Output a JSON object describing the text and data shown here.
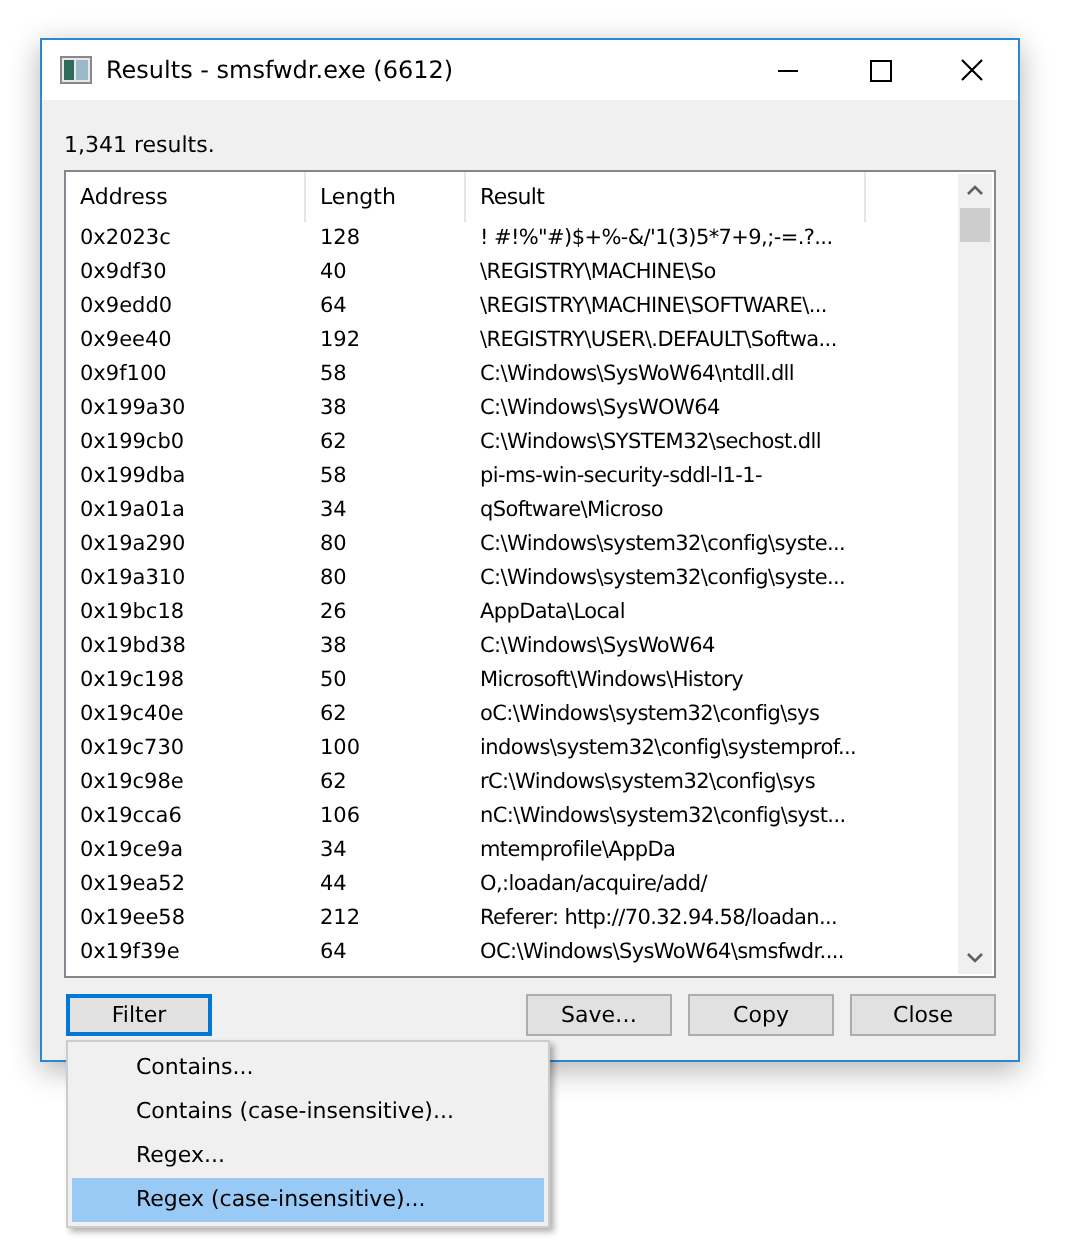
{
  "window": {
    "title": "Results - smsfwdr.exe (6612)"
  },
  "summary": "1,341 results.",
  "table": {
    "columns": [
      "Address",
      "Length",
      "Result"
    ],
    "rows": [
      [
        "0x2023c",
        "128",
        "! #!%\"#)$+%-&/'1(3)5*7+9,;-=.?..."
      ],
      [
        "0x9df30",
        "40",
        "\\REGISTRY\\MACHINE\\So"
      ],
      [
        "0x9edd0",
        "64",
        "\\REGISTRY\\MACHINE\\SOFTWARE\\..."
      ],
      [
        "0x9ee40",
        "192",
        "\\REGISTRY\\USER\\.DEFAULT\\Softwa..."
      ],
      [
        "0x9f100",
        "58",
        "C:\\Windows\\SysWoW64\\ntdll.dll"
      ],
      [
        "0x199a30",
        "38",
        "C:\\Windows\\SysWOW64"
      ],
      [
        "0x199cb0",
        "62",
        "C:\\Windows\\SYSTEM32\\sechost.dll"
      ],
      [
        "0x199dba",
        "58",
        "pi-ms-win-security-sddl-l1-1-"
      ],
      [
        "0x19a01a",
        "34",
        "qSoftware\\Microso"
      ],
      [
        "0x19a290",
        "80",
        "C:\\Windows\\system32\\config\\syste..."
      ],
      [
        "0x19a310",
        "80",
        "C:\\Windows\\system32\\config\\syste..."
      ],
      [
        "0x19bc18",
        "26",
        "AppData\\Local"
      ],
      [
        "0x19bd38",
        "38",
        "C:\\Windows\\SysWoW64"
      ],
      [
        "0x19c198",
        "50",
        "Microsoft\\Windows\\History"
      ],
      [
        "0x19c40e",
        "62",
        "oC:\\Windows\\system32\\config\\sys"
      ],
      [
        "0x19c730",
        "100",
        "indows\\system32\\config\\systemprof..."
      ],
      [
        "0x19c98e",
        "62",
        "rC:\\Windows\\system32\\config\\sys"
      ],
      [
        "0x19cca6",
        "106",
        "nC:\\Windows\\system32\\config\\syst..."
      ],
      [
        "0x19ce9a",
        "34",
        "mtemprofile\\AppDa"
      ],
      [
        "0x19ea52",
        "44",
        "O,:loadan/acquire/add/"
      ],
      [
        "0x19ee58",
        "212",
        "Referer: http://70.32.94.58/loadan..."
      ],
      [
        "0x19f39e",
        "64",
        "OC:\\Windows\\SysWoW64\\smsfwdr...."
      ]
    ]
  },
  "buttons": [
    {
      "label": "Filter",
      "focused": true
    },
    {
      "label": "Save…",
      "focused": false
    },
    {
      "label": "Copy",
      "focused": false
    },
    {
      "label": "Close",
      "focused": false
    }
  ],
  "filter_menu": {
    "items": [
      {
        "label": "Contains...",
        "selected": false
      },
      {
        "label": "Contains (case-insensitive)...",
        "selected": false
      },
      {
        "label": "Regex...",
        "selected": false
      },
      {
        "label": "Regex (case-insensitive)...",
        "selected": true
      }
    ]
  }
}
